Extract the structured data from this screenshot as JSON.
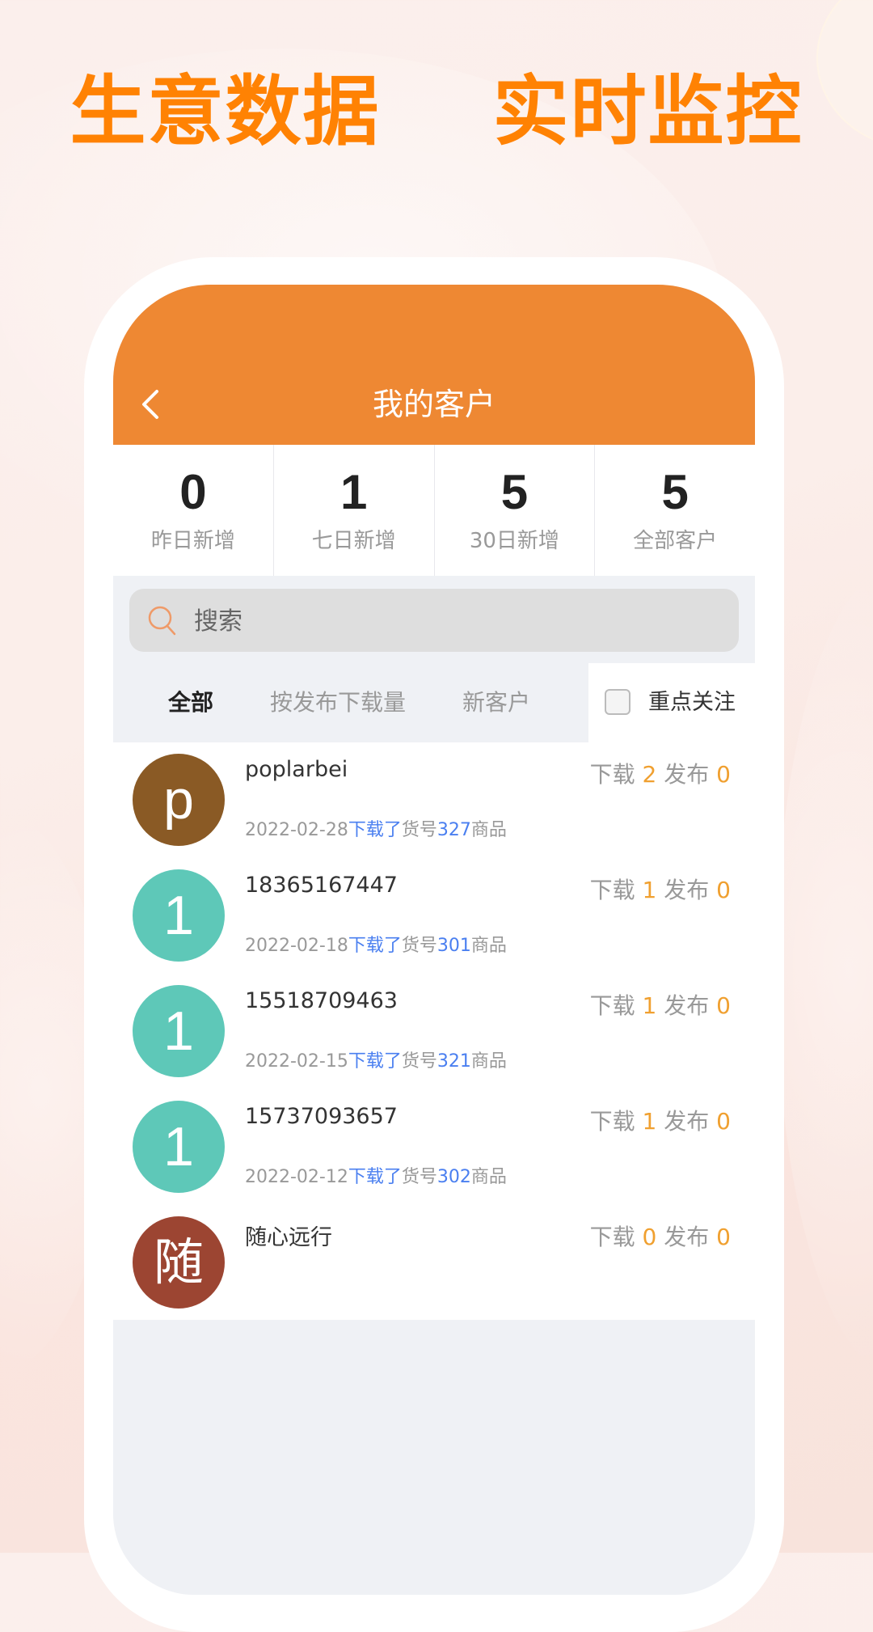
{
  "headline": "生意数据    实时监控",
  "colors": {
    "headline": "#ff8203",
    "navbar": "#ee8833",
    "count_number": "#f0a030",
    "link_blue": "#4a7ff0"
  },
  "navbar": {
    "back_icon": "chevron-left-icon",
    "title": "我的客户"
  },
  "stats": [
    {
      "value": "0",
      "label": "昨日新增"
    },
    {
      "value": "1",
      "label": "七日新增"
    },
    {
      "value": "5",
      "label": "30日新增"
    },
    {
      "value": "5",
      "label": "全部客户"
    }
  ],
  "search": {
    "icon": "search-icon",
    "placeholder": "搜索",
    "value": ""
  },
  "tabs": [
    {
      "label": "全部",
      "active": true
    },
    {
      "label": "按发布下载量",
      "active": false
    },
    {
      "label": "新客户",
      "active": false
    }
  ],
  "focus_filter": {
    "label": "重点关注",
    "checked": false
  },
  "customers": [
    {
      "avatar_text": "p",
      "avatar_color": "#8a5a25",
      "name": "poplarbei",
      "download_label": "下载",
      "downloads": "2",
      "publish_label": "发布",
      "publishes": "0",
      "activity": {
        "date": "2022-02-28",
        "action": "下载了",
        "item_prefix": "货号",
        "item_no": "327",
        "item_suffix": "商品"
      }
    },
    {
      "avatar_text": "1",
      "avatar_color": "#5ec8b8",
      "name": "18365167447",
      "download_label": "下载",
      "downloads": "1",
      "publish_label": "发布",
      "publishes": "0",
      "activity": {
        "date": "2022-02-18",
        "action": "下载了",
        "item_prefix": "货号",
        "item_no": "301",
        "item_suffix": "商品"
      }
    },
    {
      "avatar_text": "1",
      "avatar_color": "#5ec8b8",
      "name": "15518709463",
      "download_label": "下载",
      "downloads": "1",
      "publish_label": "发布",
      "publishes": "0",
      "activity": {
        "date": "2022-02-15",
        "action": "下载了",
        "item_prefix": "货号",
        "item_no": "321",
        "item_suffix": "商品"
      }
    },
    {
      "avatar_text": "1",
      "avatar_color": "#5ec8b8",
      "name": "15737093657",
      "download_label": "下载",
      "downloads": "1",
      "publish_label": "发布",
      "publishes": "0",
      "activity": {
        "date": "2022-02-12",
        "action": "下载了",
        "item_prefix": "货号",
        "item_no": "302",
        "item_suffix": "商品"
      }
    },
    {
      "avatar_text": "随",
      "avatar_color": "#9c4532",
      "name": "随心远行",
      "download_label": "下载",
      "downloads": "0",
      "publish_label": "发布",
      "publishes": "0",
      "activity": null
    }
  ]
}
